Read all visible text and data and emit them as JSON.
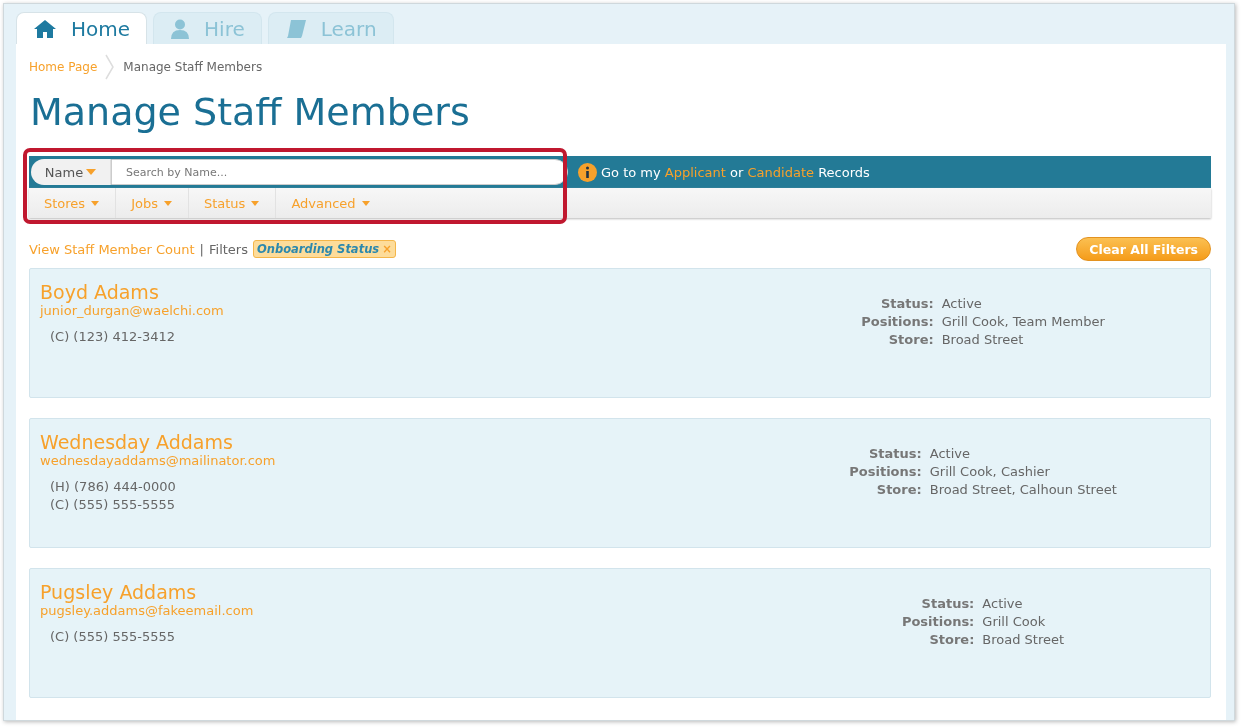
{
  "tabs": [
    {
      "label": "Home",
      "selected": true
    },
    {
      "label": "Hire",
      "selected": false
    },
    {
      "label": "Learn",
      "selected": false
    }
  ],
  "breadcrumb": [
    {
      "label": "Home Page",
      "kind": "link"
    },
    {
      "label": "Manage Staff Members",
      "kind": "current"
    }
  ],
  "title": "Manage Staff Members",
  "search": {
    "field_label": "Name",
    "placeholder": "Search by Name..."
  },
  "notice": [
    {
      "text": "Go to my",
      "kind": "text"
    },
    {
      "text": "Applicant",
      "kind": "link"
    },
    {
      "text": "or",
      "kind": "text"
    },
    {
      "text": "Candidate",
      "kind": "link"
    },
    {
      "text": "Records",
      "kind": "text"
    }
  ],
  "filter_menus": [
    "Stores",
    "Jobs",
    "Status",
    "Advanced"
  ],
  "count_link": "View Staff Member Count",
  "separator": "|",
  "filters_label": "Filters",
  "active_filters": [
    {
      "label": "Onboarding Status",
      "remove": "×"
    }
  ],
  "clear_button": "Clear All Filters",
  "staff": [
    {
      "name": "Boyd Adams",
      "email": "junior_durgan@waelchi.com",
      "phones": [
        "(C) (123) 412-3412"
      ],
      "details": [
        {
          "label": "Status:",
          "value": "Active"
        },
        {
          "label": "Positions:",
          "value": "Grill Cook, Team Member"
        },
        {
          "label": "Store:",
          "value": "Broad Street"
        }
      ]
    },
    {
      "name": "Wednesday Addams",
      "email": "wednesdayaddams@mailinator.com",
      "phones": [
        "(H) (786) 444-0000",
        "(C) (555) 555-5555"
      ],
      "details": [
        {
          "label": "Status:",
          "value": "Active"
        },
        {
          "label": "Positions:",
          "value": "Grill Cook, Cashier"
        },
        {
          "label": "Store:",
          "value": "Broad Street, Calhoun Street"
        }
      ]
    },
    {
      "name": "Pugsley Addams",
      "email": "pugsley.addams@fakeemail.com",
      "phones": [
        "(C) (555) 555-5555"
      ],
      "details": [
        {
          "label": "Status:",
          "value": "Active"
        },
        {
          "label": "Positions:",
          "value": "Grill Cook"
        },
        {
          "label": "Store:",
          "value": "Broad Street"
        }
      ]
    }
  ]
}
